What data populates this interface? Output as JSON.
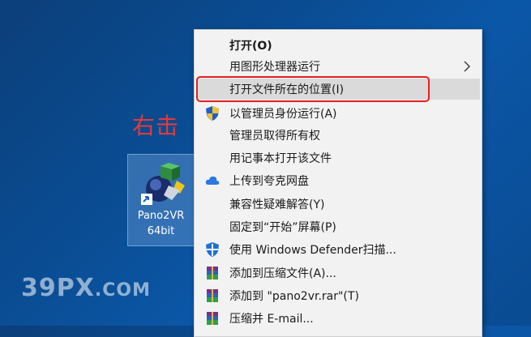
{
  "annotation": {
    "text": "右击",
    "color": "#e23b3b"
  },
  "desktop_icon": {
    "line1": "Pano2VR",
    "line2": "64bit"
  },
  "watermark": {
    "main": "39PX",
    "suffix": ".COM"
  },
  "context_menu": {
    "items": [
      {
        "label": "打开(O)",
        "icon": "none",
        "bold": true
      },
      {
        "label": "用图形处理器运行",
        "icon": "none",
        "submenu": true
      },
      {
        "label": "打开文件所在的位置(I)",
        "icon": "none",
        "highlighted": true
      },
      {
        "label": "以管理员身份运行(A)",
        "icon": "uac-shield-icon"
      },
      {
        "label": "管理员取得所有权",
        "icon": "none"
      },
      {
        "label": "用记事本打开该文件",
        "icon": "none"
      },
      {
        "label": "上传到夸克网盘",
        "icon": "cloud-icon"
      },
      {
        "label": "兼容性疑难解答(Y)",
        "icon": "none"
      },
      {
        "label": "固定到“开始”屏幕(P)",
        "icon": "none"
      },
      {
        "label": "使用 Windows Defender扫描...",
        "icon": "defender-shield-icon"
      },
      {
        "label": "添加到压缩文件(A)...",
        "icon": "winrar-icon"
      },
      {
        "label": "添加到 \"pano2vr.rar\"(T)",
        "icon": "winrar-icon"
      },
      {
        "label": "压缩并 E-mail...",
        "icon": "winrar-icon"
      }
    ]
  },
  "colors": {
    "highlight_border": "#e32020",
    "menu_bg": "#f2f2f2",
    "hover_bg": "#dadada"
  }
}
